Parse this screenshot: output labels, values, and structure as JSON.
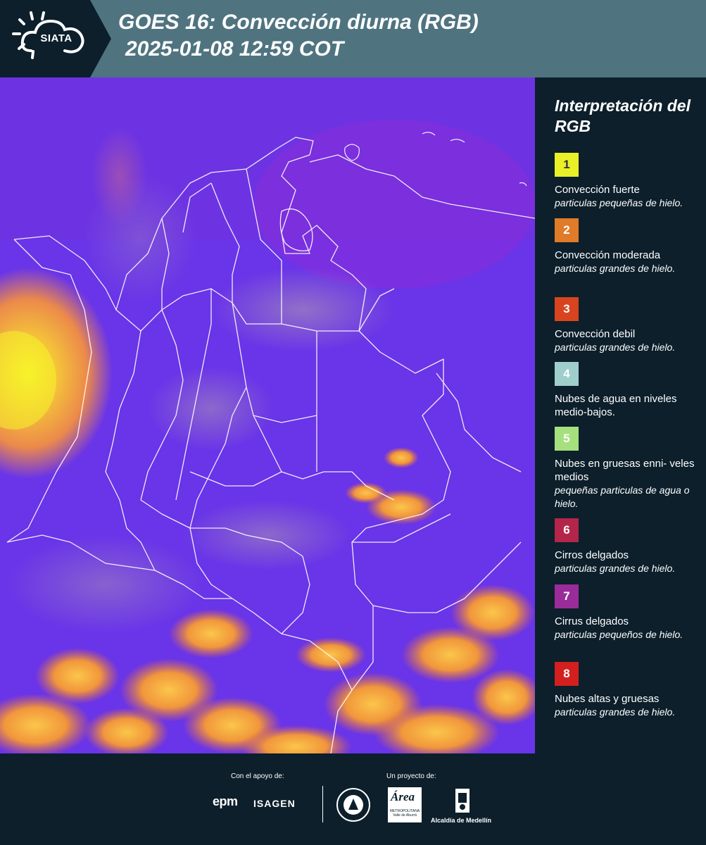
{
  "header": {
    "logo_text": "SIATA",
    "title": "GOES 16: Convección diurna (RGB)",
    "datetime": "2025-01-08 12:59 COT"
  },
  "map": {
    "description_icon": "satellite-rgb-map",
    "background_color": "#6a34e8"
  },
  "legend": {
    "title": "Interpretación del RGB",
    "items": [
      {
        "number": "1",
        "color": "#e9f027",
        "text_color": "#333333",
        "label": "Convección fuerte",
        "note": "particulas pequeñas de hielo."
      },
      {
        "number": "2",
        "color": "#e07b2a",
        "text_color": "#ffffff",
        "label": "Convección moderada",
        "note": "particulas grandes de hielo."
      },
      {
        "number": "3",
        "color": "#d8441f",
        "text_color": "#ffffff",
        "label": "Convección debil",
        "note": "particulas grandes de hielo."
      },
      {
        "number": "4",
        "color": "#9fcfcc",
        "text_color": "#ffffff",
        "label": "Nubes de agua en niveles medio-bajos.",
        "note": ""
      },
      {
        "number": "5",
        "color": "#a6e07e",
        "text_color": "#ffffff",
        "label": "Nubes en gruesas enni- veles medios",
        "note": "pequeñas particulas de agua o hielo."
      },
      {
        "number": "6",
        "color": "#b3264a",
        "text_color": "#ffffff",
        "label": "Cirros delgados",
        "note": "particulas grandes de hielo."
      },
      {
        "number": "7",
        "color": "#9a2c9a",
        "text_color": "#ffffff",
        "label": "Cirrus delgados",
        "note": "particulas pequeños de hielo."
      },
      {
        "number": "8",
        "color": "#d3201f",
        "text_color": "#ffffff",
        "label": "Nubes altas y gruesas",
        "note": "particulas grandes de hielo."
      }
    ]
  },
  "footer": {
    "support_label": "Con el apoyo de:",
    "project_label": "Un proyecto de:",
    "epm": "epm",
    "isagen": "ISAGEN",
    "area_word": "Área",
    "area_sub": "METROPOLITANA Valle de Aburrá",
    "medellin": "Alcaldía de Medellín"
  }
}
